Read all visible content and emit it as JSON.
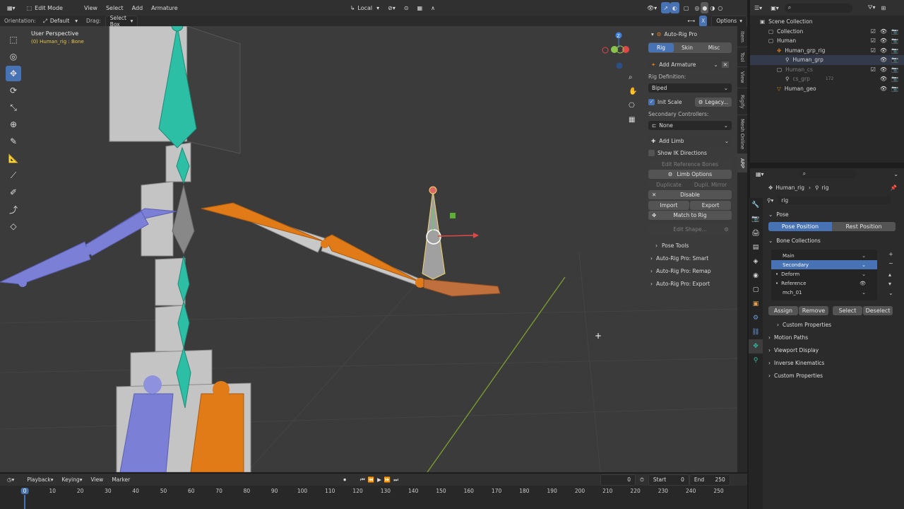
{
  "header": {
    "mode": "Edit Mode",
    "menus": [
      "View",
      "Select",
      "Add",
      "Armature"
    ],
    "transform_space": "Local"
  },
  "tool_header": {
    "orientation_label": "Orientation:",
    "orientation_value": "Default",
    "drag_label": "Drag:",
    "drag_value": "Select Box",
    "options": "Options"
  },
  "viewport": {
    "perspective": "User Perspective",
    "active": "(0) Human_rig : Bone"
  },
  "npanel": {
    "title": "Auto-Rig Pro",
    "tabs": [
      "Rig",
      "Skin",
      "Misc"
    ],
    "add_armature": "Add Armature",
    "rig_definition_label": "Rig Definition:",
    "rig_definition": "Biped",
    "init_scale": "Init Scale",
    "legacy": "Legacy...",
    "secondary_label": "Secondary Controllers:",
    "secondary": "None",
    "add_limb": "Add Limb",
    "show_ik": "Show IK Directions",
    "edit_ref_bones": "Edit Reference Bones",
    "limb_options": "Limb Options",
    "duplicate": "Duplicate",
    "dupli_mirror": "Dupli. Mirror",
    "disable": "Disable",
    "import": "Import",
    "export": "Export",
    "match_to_rig": "Match to Rig",
    "edit_shape": "Edit Shape...",
    "pose_tools": "Pose Tools",
    "smart": "Auto-Rig Pro: Smart",
    "remap": "Auto-Rig Pro: Remap",
    "export_panel": "Auto-Rig Pro: Export"
  },
  "side_tabs": [
    "Item",
    "Tool",
    "View",
    "Rigify",
    "Mesh Online",
    "ARP"
  ],
  "outliner": {
    "rows": [
      {
        "label": "Scene Collection",
        "indent": 0
      },
      {
        "label": "Collection",
        "indent": 1
      },
      {
        "label": "Human",
        "indent": 1
      },
      {
        "label": "Human_grp_rig",
        "indent": 2
      },
      {
        "label": "Human_grp",
        "indent": 3
      },
      {
        "label": "Human_cs",
        "indent": 2
      },
      {
        "label": "cs_grp",
        "indent": 3
      },
      {
        "label": "Human_geo",
        "indent": 2
      }
    ],
    "cs_count": "172"
  },
  "props": {
    "breadcrumb_obj": "Human_rig",
    "breadcrumb_data": "rig",
    "data_name": "rig",
    "pose": "Pose",
    "pose_position": "Pose Position",
    "rest_position": "Rest Position",
    "bone_collections": "Bone Collections",
    "collections": [
      "Main",
      "Secondary",
      "Deform",
      "Reference",
      "mch_01"
    ],
    "assign": "Assign",
    "remove": "Remove",
    "select": "Select",
    "deselect": "Deselect",
    "custom_props_inner": "Custom Properties",
    "motion_paths": "Motion Paths",
    "viewport_display": "Viewport Display",
    "inverse_kinematics": "Inverse Kinematics",
    "custom_props": "Custom Properties"
  },
  "timeline": {
    "menus": [
      "Playback",
      "Keying",
      "View",
      "Marker"
    ],
    "current_frame": "0",
    "start_label": "Start",
    "start": "0",
    "end_label": "End",
    "end": "250",
    "ticks": [
      "0",
      "10",
      "20",
      "30",
      "40",
      "50",
      "60",
      "70",
      "80",
      "90",
      "100",
      "110",
      "120",
      "130",
      "140",
      "150",
      "160",
      "170",
      "180",
      "190",
      "200",
      "210",
      "220",
      "230",
      "240",
      "250"
    ]
  },
  "colors": {
    "accent": "#4772b3",
    "orange": "#e07b18",
    "teal": "#2dbfa5",
    "purple": "#7b7fd6",
    "bone_grey": "#c8c8c8"
  }
}
